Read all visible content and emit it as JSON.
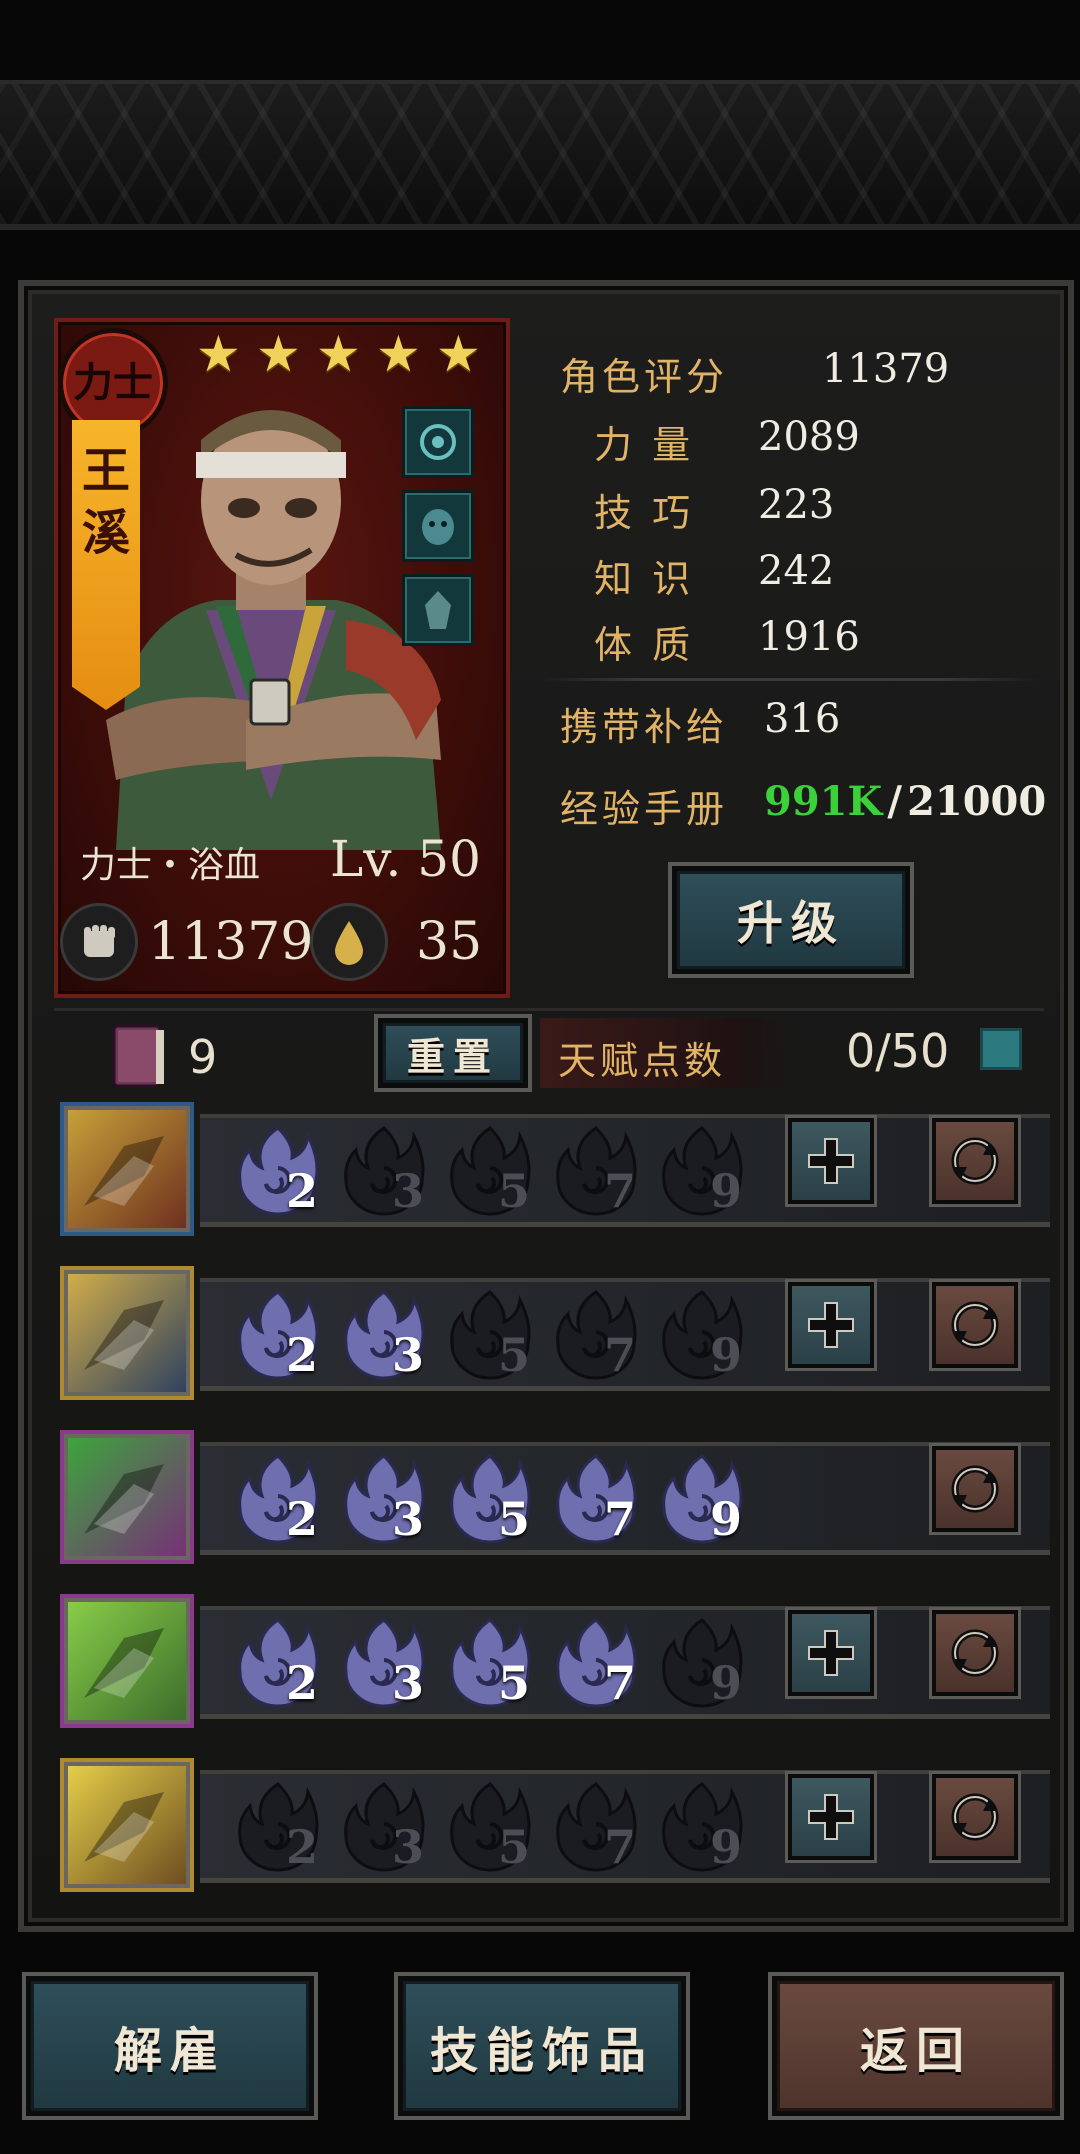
{
  "character": {
    "class_badge": "力士",
    "name_chars": [
      "王",
      "溪"
    ],
    "stars": 5,
    "class_path": "力士・浴血",
    "level": "Lv. 50",
    "power_value": "11379",
    "resolve_value": "35"
  },
  "stats": {
    "rating_label": "角色评分",
    "rating_value": "11379",
    "rows": [
      {
        "label": "力 量",
        "value": "2089"
      },
      {
        "label": "技 巧",
        "value": "223"
      },
      {
        "label": "知 识",
        "value": "242"
      },
      {
        "label": "体 质",
        "value": "1916"
      }
    ],
    "supply_label": "携带补给",
    "supply_value": "316",
    "exp_label": "经验手册",
    "exp_current": "991K",
    "exp_sep": "/",
    "exp_required": "21000",
    "upgrade_label": "升级"
  },
  "talent": {
    "book_count": "9",
    "reset_label": "重置",
    "points_label": "天赋点数",
    "points_value": "0/50"
  },
  "skills": [
    {
      "name": "skill-slash",
      "levels": [
        "2",
        "3",
        "5",
        "7",
        "9"
      ],
      "unlocked": 1,
      "has_plus": true,
      "colors": [
        "#c9a43a",
        "#6b2d1e"
      ],
      "frame": "#2e5a8a"
    },
    {
      "name": "skill-leap",
      "levels": [
        "2",
        "3",
        "5",
        "7",
        "9"
      ],
      "unlocked": 2,
      "has_plus": true,
      "colors": [
        "#d6b04a",
        "#2a3e60"
      ],
      "frame": "#b08a32"
    },
    {
      "name": "skill-flex",
      "levels": [
        "2",
        "3",
        "5",
        "7",
        "9"
      ],
      "unlocked": 5,
      "has_plus": false,
      "colors": [
        "#3aa83a",
        "#7a2c7a"
      ],
      "frame": "#8a3a8a"
    },
    {
      "name": "skill-strike",
      "levels": [
        "2",
        "3",
        "5",
        "7",
        "9"
      ],
      "unlocked": 4,
      "has_plus": true,
      "colors": [
        "#8ad04a",
        "#3a6a2a"
      ],
      "frame": "#8a3a8a"
    },
    {
      "name": "skill-fist",
      "levels": [
        "2",
        "3",
        "5",
        "7",
        "9"
      ],
      "unlocked": 0,
      "has_plus": true,
      "colors": [
        "#e8d24a",
        "#6a4a20"
      ],
      "frame": "#b08a32"
    }
  ],
  "bottom": {
    "dismiss_label": "解雇",
    "trinkets_label": "技能饰品",
    "back_label": "返回"
  },
  "colors": {
    "exp_current": "#3ad13a",
    "label_gold": "#e0b367",
    "flame_on": "#6f6fb0",
    "flame_off": "#1a1c22"
  }
}
